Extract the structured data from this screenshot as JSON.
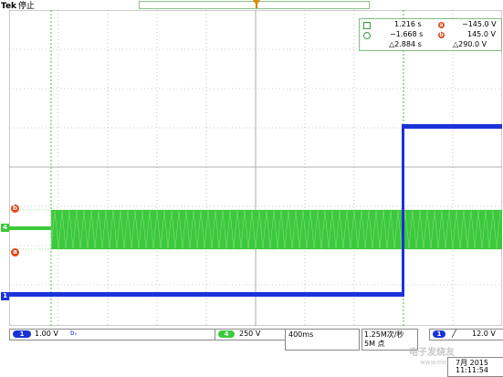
{
  "header": {
    "brand": "Tek",
    "status": "停止"
  },
  "readout": {
    "cursor_a_time": "1.216 s",
    "cursor_b_time": "−1.668 s",
    "delta_time": "△2.884 s",
    "cursor_a_volt": "−145.0 V",
    "cursor_b_volt": "145.0 V",
    "delta_volt": "△290.0 V",
    "a_label": "a",
    "b_label": "b"
  },
  "markers": {
    "ref_b": "b",
    "ref_a": "a",
    "ch4": "4",
    "ch1": "1"
  },
  "bottom": {
    "ch1_number": "1",
    "ch1_scale": "1.00 V",
    "ch1_coupling": "bᵥ",
    "ch4_number": "4",
    "ch4_scale": "250 V",
    "timebase": "400ms",
    "sample_rate": "1.25M次/秒",
    "record_length": "5M 点",
    "trig_source": "1",
    "trig_slope": "╱",
    "trig_level": "12.0 V",
    "date": "7月 2015",
    "time": "11:11:54"
  },
  "watermark": {
    "text": "电子发烧友",
    "sub": "www.elecfans.com"
  },
  "colors": {
    "ch1": "#1a33d9",
    "ch4": "#3cc93c",
    "cursor": "#e04818",
    "grid": "#9a9a9a"
  }
}
